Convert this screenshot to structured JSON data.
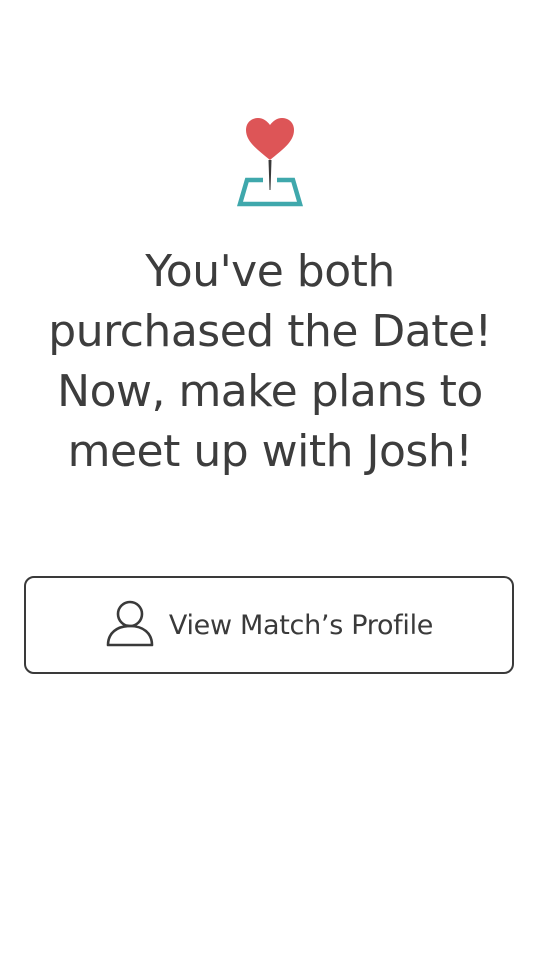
{
  "headline": {
    "lines": [
      "You've both",
      "purchased the Date!",
      "Now, make plans to",
      "meet up with Josh!"
    ]
  },
  "icons": {
    "hero": "heart-pin-map-icon",
    "profile": "person-icon"
  },
  "colors": {
    "heart": "#dd5557",
    "map": "#3fa8ac",
    "pin": "#3a3a3a",
    "text": "#3d3d3d",
    "button_border": "#3a3a3a"
  },
  "actions": {
    "view_profile_label": "View Match’s Profile"
  }
}
